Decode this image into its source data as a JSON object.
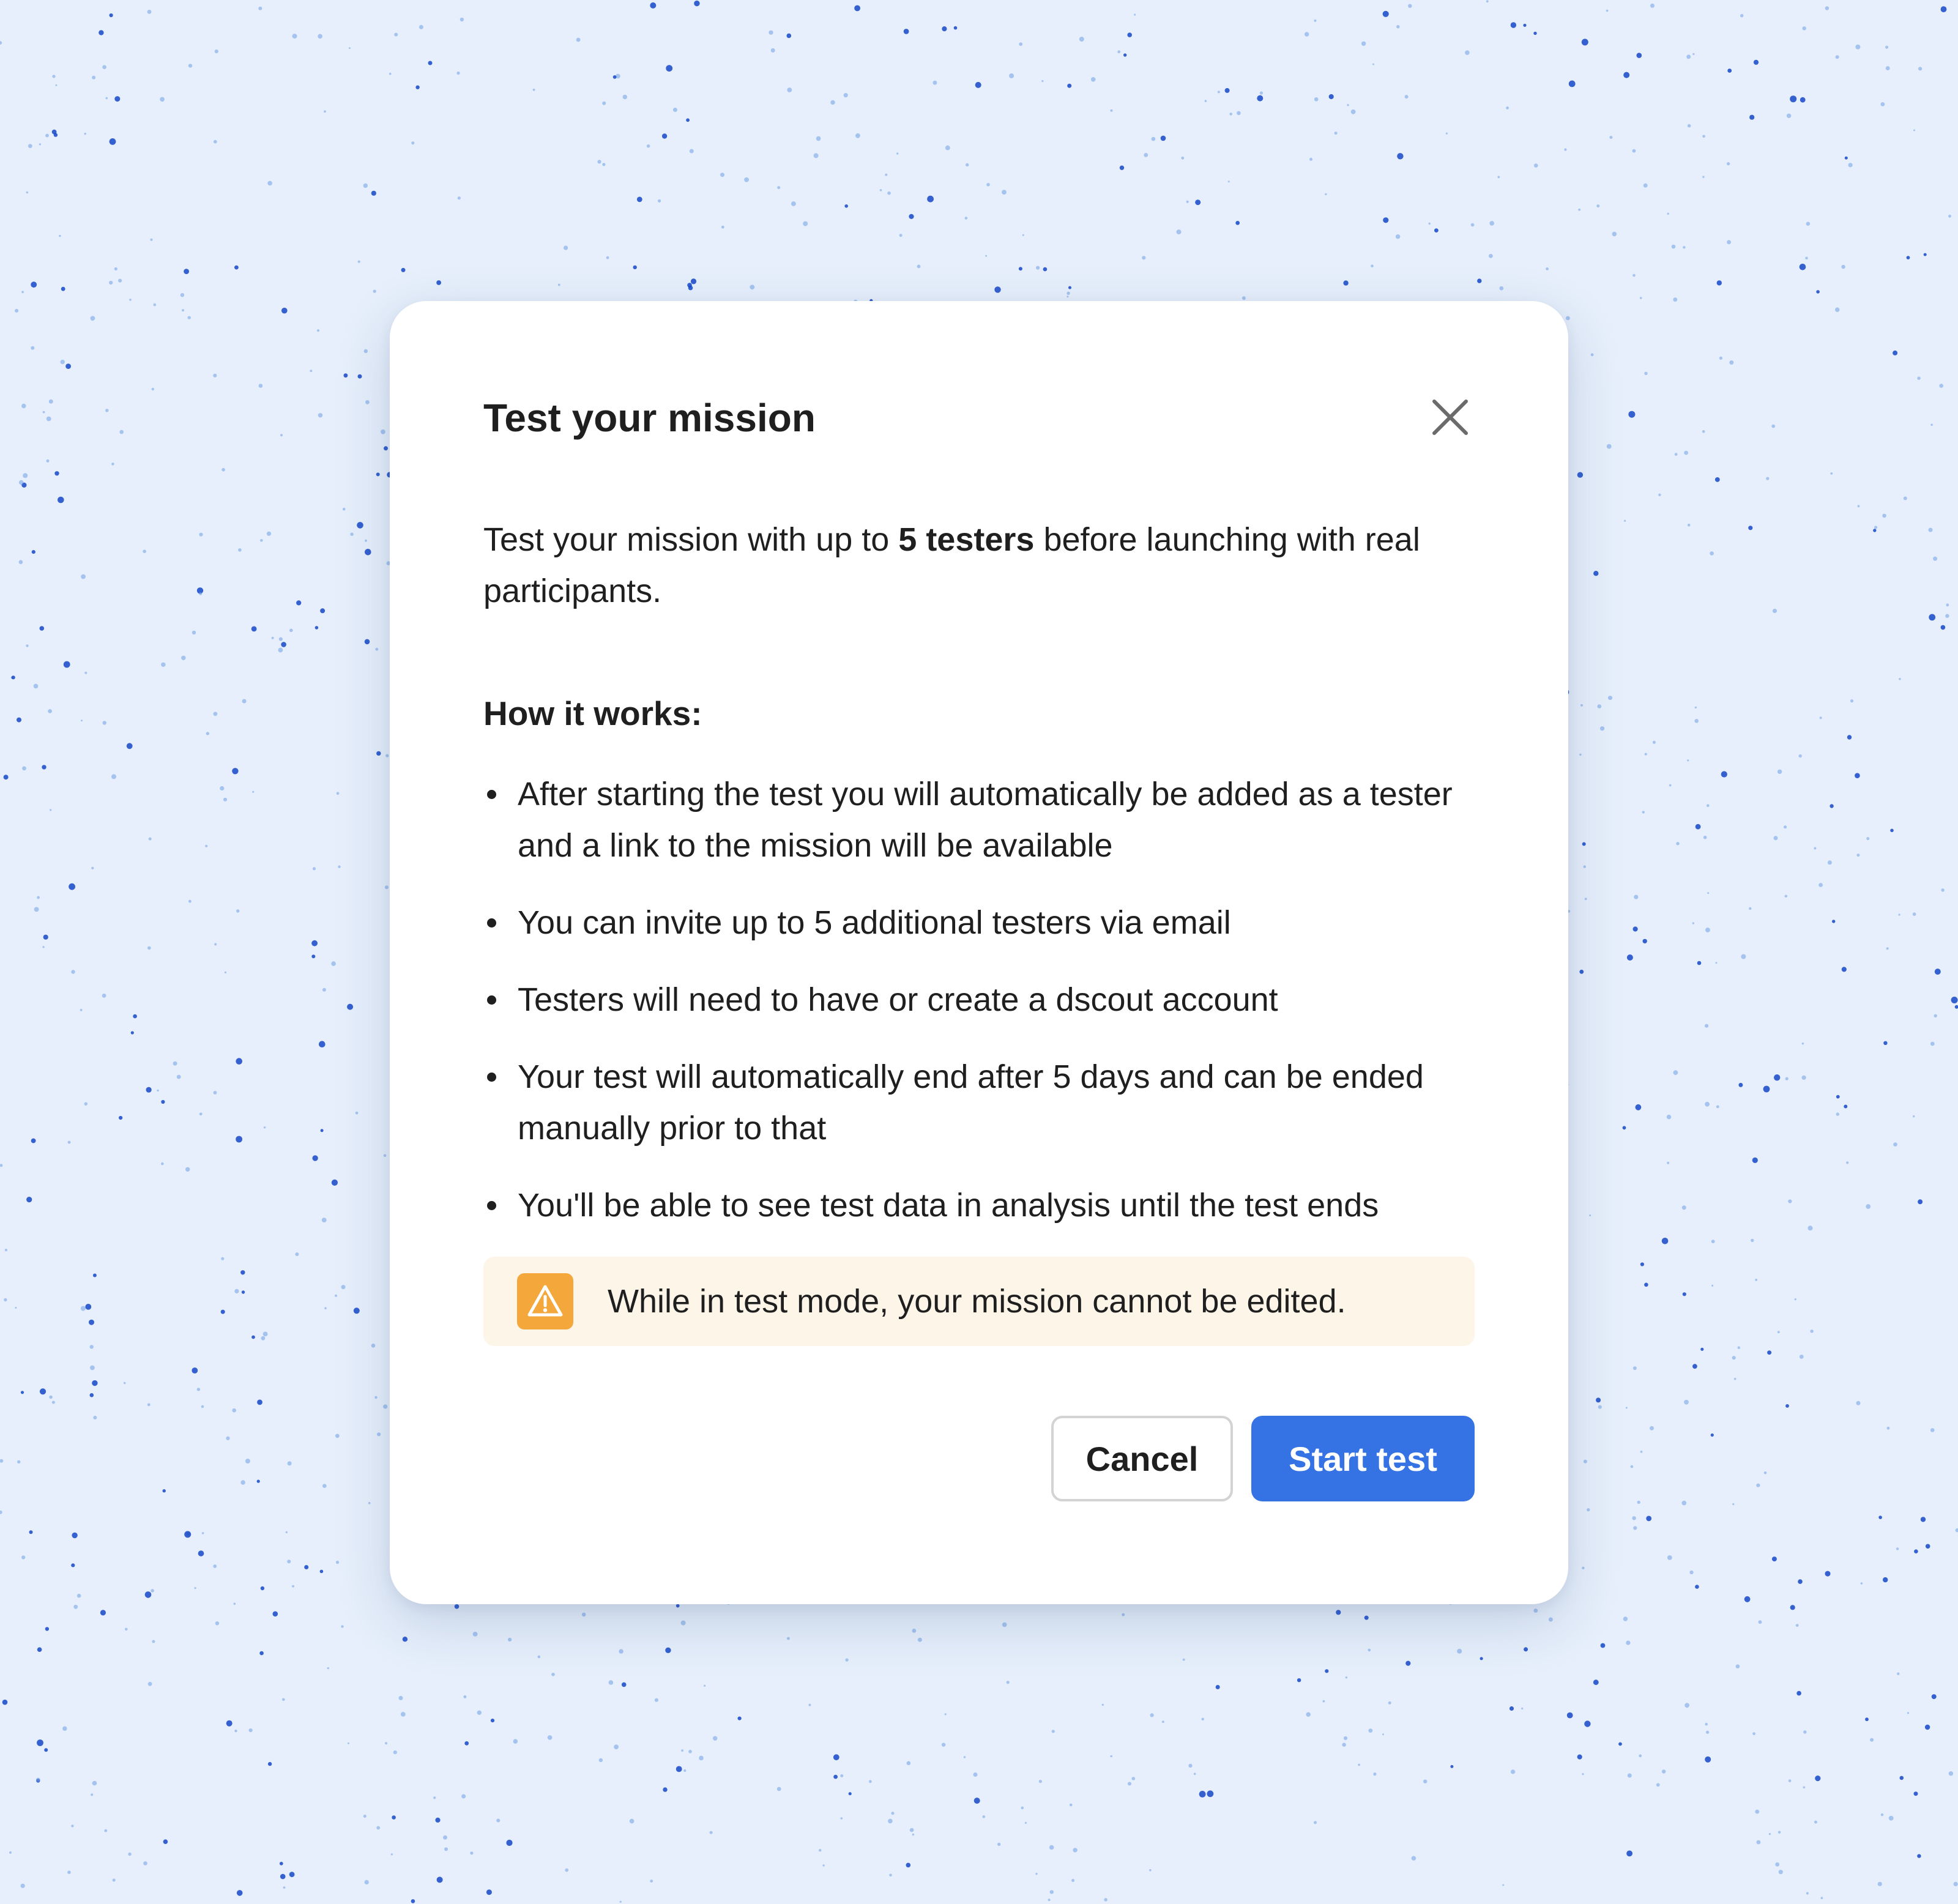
{
  "colors": {
    "background": "#e6effb",
    "speckle_dark": "#1447c8",
    "speckle_light": "#6f9ee6",
    "primary": "#3572e3",
    "warning_bg": "#fdf5e8",
    "warning_icon_bg": "#f4a73a"
  },
  "dialog": {
    "title": "Test your mission",
    "close_icon": "close-icon",
    "intro": {
      "before": "Test your mission with up to ",
      "emphasis": "5 testers",
      "after": " before launching with real participants."
    },
    "how_it_works_heading": "How it works:",
    "steps": [
      "After starting the test you will automatically be added as a tester and a link to the mission will be available",
      "You can invite up to 5 additional testers via email",
      "Testers will need to have or create a dscout account",
      "Your test will automatically end after 5 days and can be ended manually prior to that",
      "You'll be able to see test data in analysis until the test ends"
    ],
    "warning": {
      "icon": "warning-icon",
      "text": "While in test mode, your mission cannot be edited."
    },
    "actions": {
      "cancel_label": "Cancel",
      "start_label": "Start test"
    }
  }
}
